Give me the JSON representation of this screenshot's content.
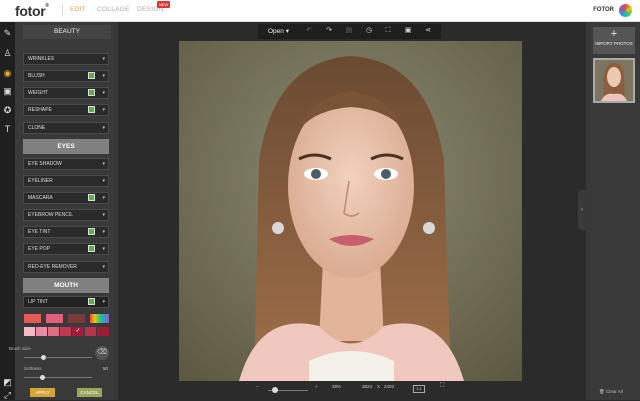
{
  "app": {
    "logo": "fotor",
    "logo_mark": "®",
    "nav": {
      "edit": "EDIT",
      "collage": "COLLAGE",
      "design": "DESIGN",
      "new_badge": "NEW"
    },
    "brand_right": "FOTOR"
  },
  "left_tools": [
    {
      "icon": "pencil-icon"
    },
    {
      "icon": "stamp-icon"
    },
    {
      "icon": "eye-icon",
      "active": true
    },
    {
      "icon": "frame-icon"
    },
    {
      "icon": "sticker-icon"
    },
    {
      "icon": "text-icon"
    },
    {
      "icon": "crop-icon"
    },
    {
      "icon": "expand-icon"
    }
  ],
  "panel": {
    "title": "BEAUTY",
    "rows_top": [
      "WRINKLES",
      "BLUSH",
      "WEIGHT",
      "RESHAPE",
      "CLONE"
    ],
    "eyes_section": "EYES",
    "rows_eyes": [
      "EYE SHADOW",
      "EYELINER",
      "MASCARA",
      "EYEBROW PENCIL",
      "EYE TINT",
      "EYE POP",
      "RED-EYE REMOVER"
    ],
    "mouth_section": "MOUTH",
    "lip_tint": "LIP TINT",
    "brush_size_label": "Brush Size",
    "softness_label": "Softness",
    "softness_value": "50",
    "apply": "APPLY",
    "cancel": "CANCEL"
  },
  "lip_colors_row1": [
    "#e35c56",
    "#e25e7e",
    "#7a3a3a",
    "#c9a16a",
    "rainbow"
  ],
  "lip_colors_row2": [
    "#f2b9c7",
    "#e98aa7",
    "#dd6e86",
    "#c03a54",
    "#a21b3a",
    "#b8334b",
    "#9c1b36"
  ],
  "toolbar": {
    "open": "Open"
  },
  "bottombar": {
    "zoom_minus": "−",
    "zoom_plus": "+",
    "zoom": "38%",
    "width": "3824",
    "x": "X",
    "height": "2403",
    "ratio": "1:1"
  },
  "right": {
    "import": "IMPORT PHOTOS",
    "plus": "+",
    "clear_all": "Clear All"
  }
}
